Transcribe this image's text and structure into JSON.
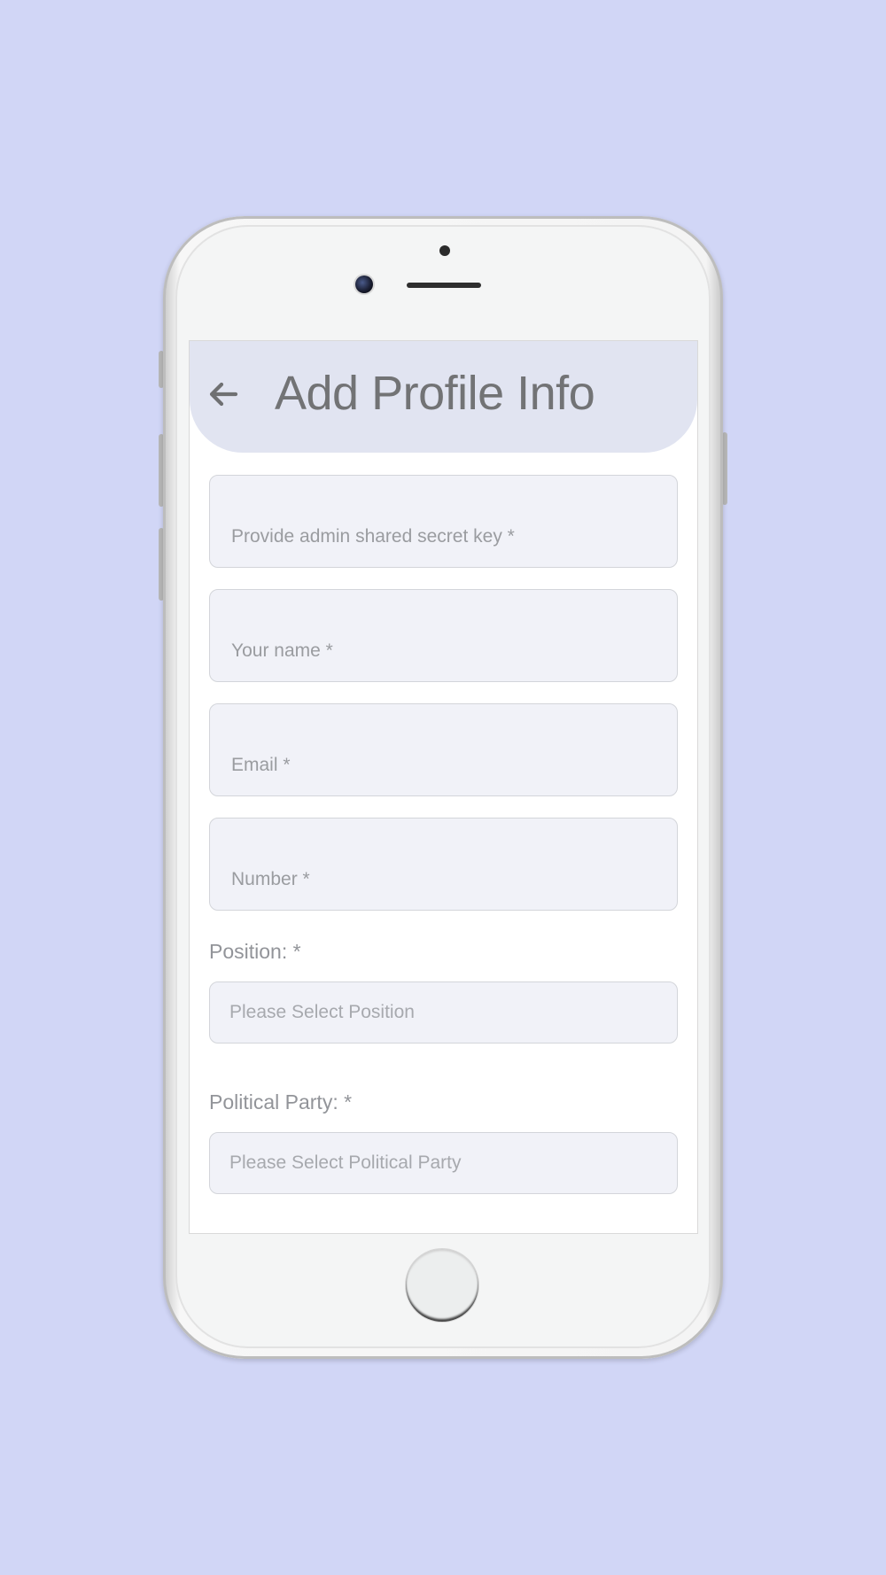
{
  "header": {
    "title": "Add Profile Info",
    "back_icon": "arrow-left-icon"
  },
  "form": {
    "secret_key": {
      "placeholder": "Provide admin shared secret key *",
      "value": ""
    },
    "name": {
      "placeholder": "Your name *",
      "value": ""
    },
    "email": {
      "placeholder": "Email *",
      "value": ""
    },
    "number": {
      "placeholder": "Number *",
      "value": ""
    },
    "position": {
      "label": "Position: *",
      "placeholder": "Please Select Position"
    },
    "party": {
      "label": "Political Party: *",
      "placeholder": "Please Select Political Party"
    }
  },
  "colors": {
    "background": "#d1d6f6",
    "header_bg": "#e1e4f1",
    "field_bg": "#f1f2f8",
    "title_text": "#727375"
  }
}
